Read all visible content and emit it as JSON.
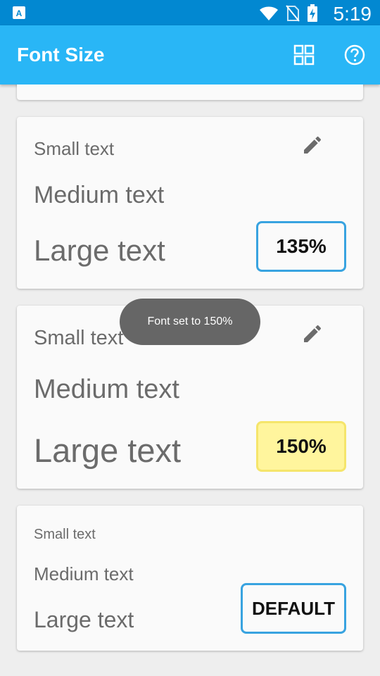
{
  "status_bar": {
    "time": "5:19",
    "icons": [
      "notification-a-icon",
      "wifi-icon",
      "no-sim-icon",
      "battery-charging-icon"
    ]
  },
  "app_bar": {
    "title": "Font Size",
    "actions": [
      "grid-icon",
      "help-icon"
    ]
  },
  "cards": [
    {
      "small": "Small text",
      "medium": "Medium text",
      "large": "Large text",
      "button": "135%",
      "selected": false,
      "has_edit": true
    },
    {
      "small": "Small text",
      "medium": "Medium text",
      "large": "Large text",
      "button": "150%",
      "selected": true,
      "has_edit": true
    },
    {
      "small": "Small text",
      "medium": "Medium text",
      "large": "Large text",
      "button": "DEFAULT",
      "selected": false,
      "has_edit": false
    }
  ],
  "toast": {
    "message": "Font set to 150%"
  },
  "colors": {
    "status_bar": "#0288d1",
    "app_bar": "#29b6f6",
    "selected_button": "#fff59d",
    "button_border": "#38a3e0"
  }
}
